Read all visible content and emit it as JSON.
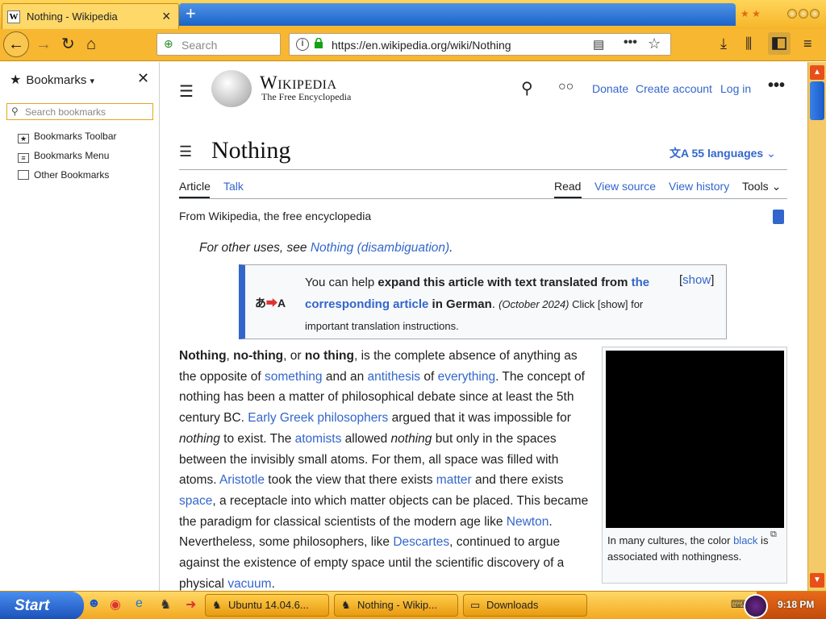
{
  "browser": {
    "tab_title": "Nothing - Wikipedia",
    "tab_favicon": "W",
    "search_placeholder": "Search",
    "url": "https://en.wikipedia.org/wiki/Nothing",
    "accent_color": "#f7b731"
  },
  "sidebar": {
    "title": "Bookmarks",
    "search_placeholder": "Search bookmarks",
    "items": [
      {
        "label": "Bookmarks Toolbar",
        "icon": "star-folder-icon"
      },
      {
        "label": "Bookmarks Menu",
        "icon": "menu-folder-icon"
      },
      {
        "label": "Other Bookmarks",
        "icon": "folder-icon"
      }
    ]
  },
  "wiki": {
    "name": "Wikipedia",
    "tagline": "The Free Encyclopedia",
    "header_links": [
      "Donate",
      "Create account",
      "Log in"
    ],
    "title": "Nothing",
    "languages": "55 languages",
    "tabs_left": [
      "Article",
      "Talk"
    ],
    "tabs_right": [
      "Read",
      "View source",
      "View history",
      "Tools"
    ],
    "from": "From Wikipedia, the free encyclopedia",
    "hatnote_prefix": "For other uses, see ",
    "hatnote_link": "Nothing (disambiguation)",
    "hatnote_suffix": ".",
    "ambox": {
      "text_a": "You can help ",
      "bold_a": "expand this article with text translated from ",
      "link": "the corresponding article",
      "bold_b": " in German",
      "date": "(October 2024)",
      "text_b": " Click [show] for important translation instructions.",
      "show": "show"
    },
    "infobox_caption_a": "In many cultures, the color ",
    "infobox_caption_link": "black",
    "infobox_caption_b": " is associated with nothingness."
  },
  "taskbar": {
    "start": "Start",
    "tasks": [
      "Ubuntu 14.04.6...",
      "Nothing - Wikip...",
      "Downloads"
    ],
    "clock": "9:18 PM"
  }
}
